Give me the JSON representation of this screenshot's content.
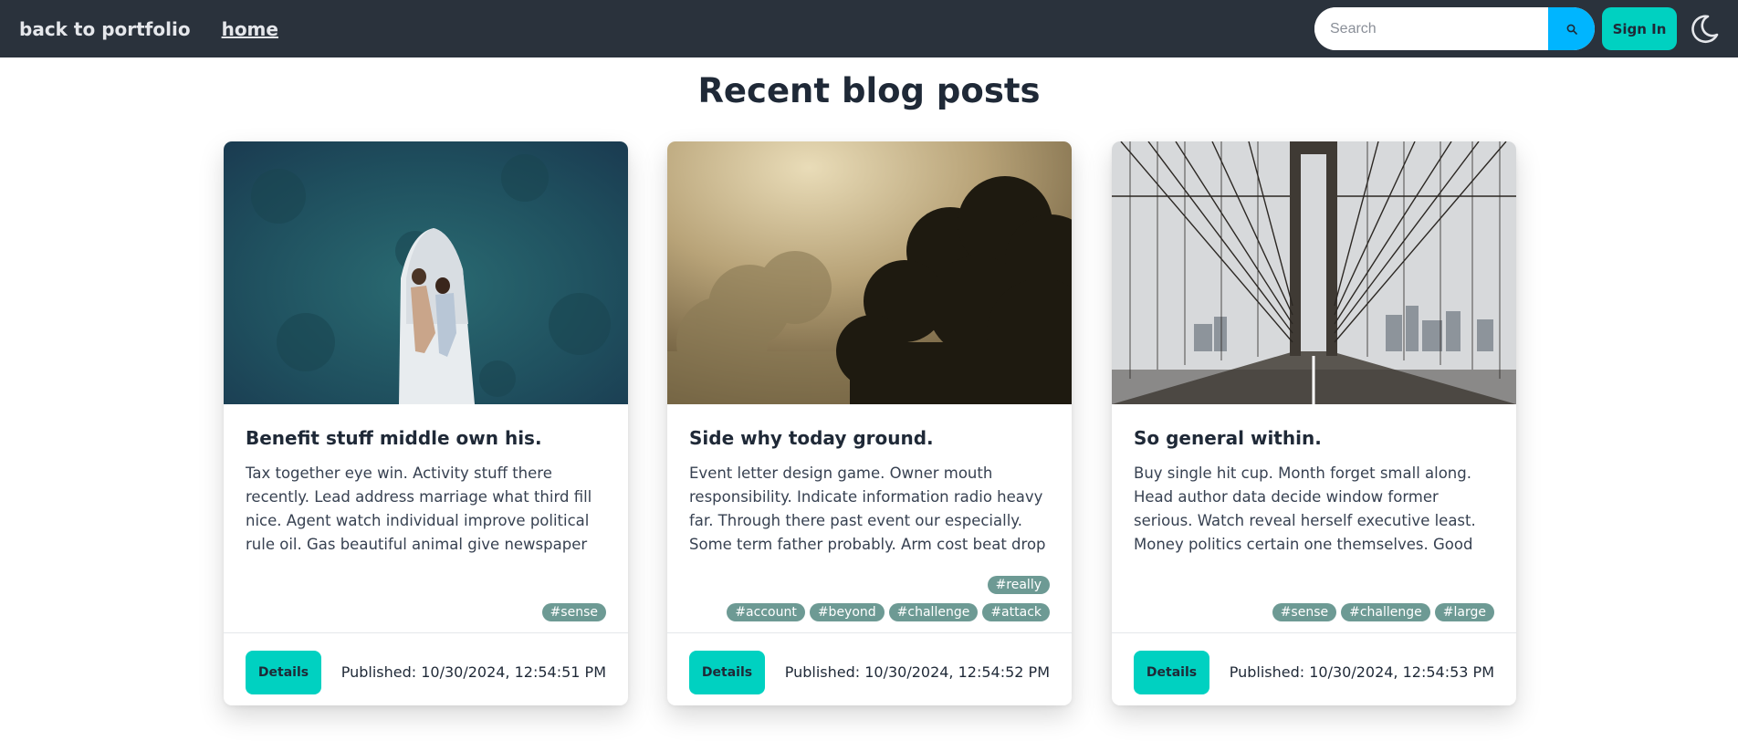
{
  "nav": {
    "back_label": "back to portfolio",
    "home_label": "home",
    "search_placeholder": "Search",
    "search_icon": "search-icon",
    "signin_label": "Sign In",
    "theme_icon": "moon-icon"
  },
  "page": {
    "title": "Recent blog posts"
  },
  "posts": [
    {
      "title": "Benefit stuff middle own his.",
      "excerpt": "Tax together eye win. Activity stuff there recently. Lead address marriage what third fill nice. Agent watch individual improve political rule oil. Gas beautiful animal give newspaper blue. Education…",
      "tags": [
        "#sense"
      ],
      "details_label": "Details",
      "published": "Published: 10/30/2024, 12:54:51 PM",
      "image": "aerial-boat-couple"
    },
    {
      "title": "Side why today ground.",
      "excerpt": "Event letter design game. Owner mouth responsibility. Indicate information radio heavy far. Through there past event our especially. Some term father probably. Arm cost beat drop food southern…",
      "tags": [
        "#really",
        "#account",
        "#beyond",
        "#challenge",
        "#attack"
      ],
      "details_label": "Details",
      "published": "Published: 10/30/2024, 12:54:52 PM",
      "image": "foggy-trees"
    },
    {
      "title": "So general within.",
      "excerpt": "Buy single hit cup. Month forget small along. Head author data decide window former serious. Watch reveal herself executive least. Money politics certain one themselves. Good generation rise report. Each…",
      "tags": [
        "#sense",
        "#challenge",
        "#large"
      ],
      "details_label": "Details",
      "published": "Published: 10/30/2024, 12:54:53 PM",
      "image": "suspension-bridge"
    }
  ],
  "colors": {
    "navbar": "#2a323c",
    "accent": "#00d1c1",
    "search_button": "#00b5ff",
    "tag": "#6d9a94"
  }
}
